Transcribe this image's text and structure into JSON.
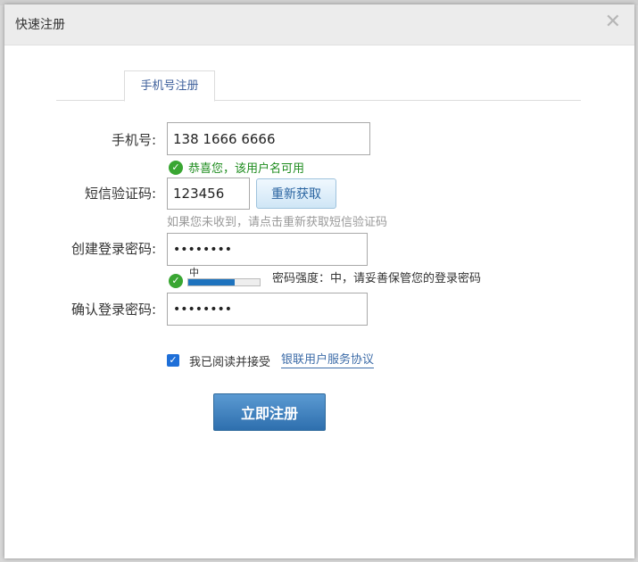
{
  "dialog": {
    "title": "快速注册",
    "close_icon": "close-icon"
  },
  "tabs": [
    {
      "label": "手机号注册",
      "active": true
    }
  ],
  "form": {
    "phone": {
      "label": "手机号:",
      "value": "138 1666 6666",
      "hint": "恭喜您，该用户名可用"
    },
    "sms": {
      "label": "短信验证码:",
      "value": "123456",
      "button": "重新获取",
      "hint": "如果您未收到，请点击重新获取短信验证码"
    },
    "password": {
      "label": "创建登录密码:",
      "value": "••••••••",
      "strength_level": "中",
      "strength_fraction": 0.65,
      "strength_text": "密码强度：中，请妥善保管您的登录密码"
    },
    "confirm": {
      "label": "确认登录密码:",
      "value": "••••••••"
    },
    "agreement": {
      "checked": true,
      "text": "我已阅读并接受",
      "link": "银联用户服务协议"
    },
    "submit": "立即注册"
  },
  "colors": {
    "accent": "#2e6fae",
    "success": "#39a632",
    "link": "#3d6ca8"
  }
}
